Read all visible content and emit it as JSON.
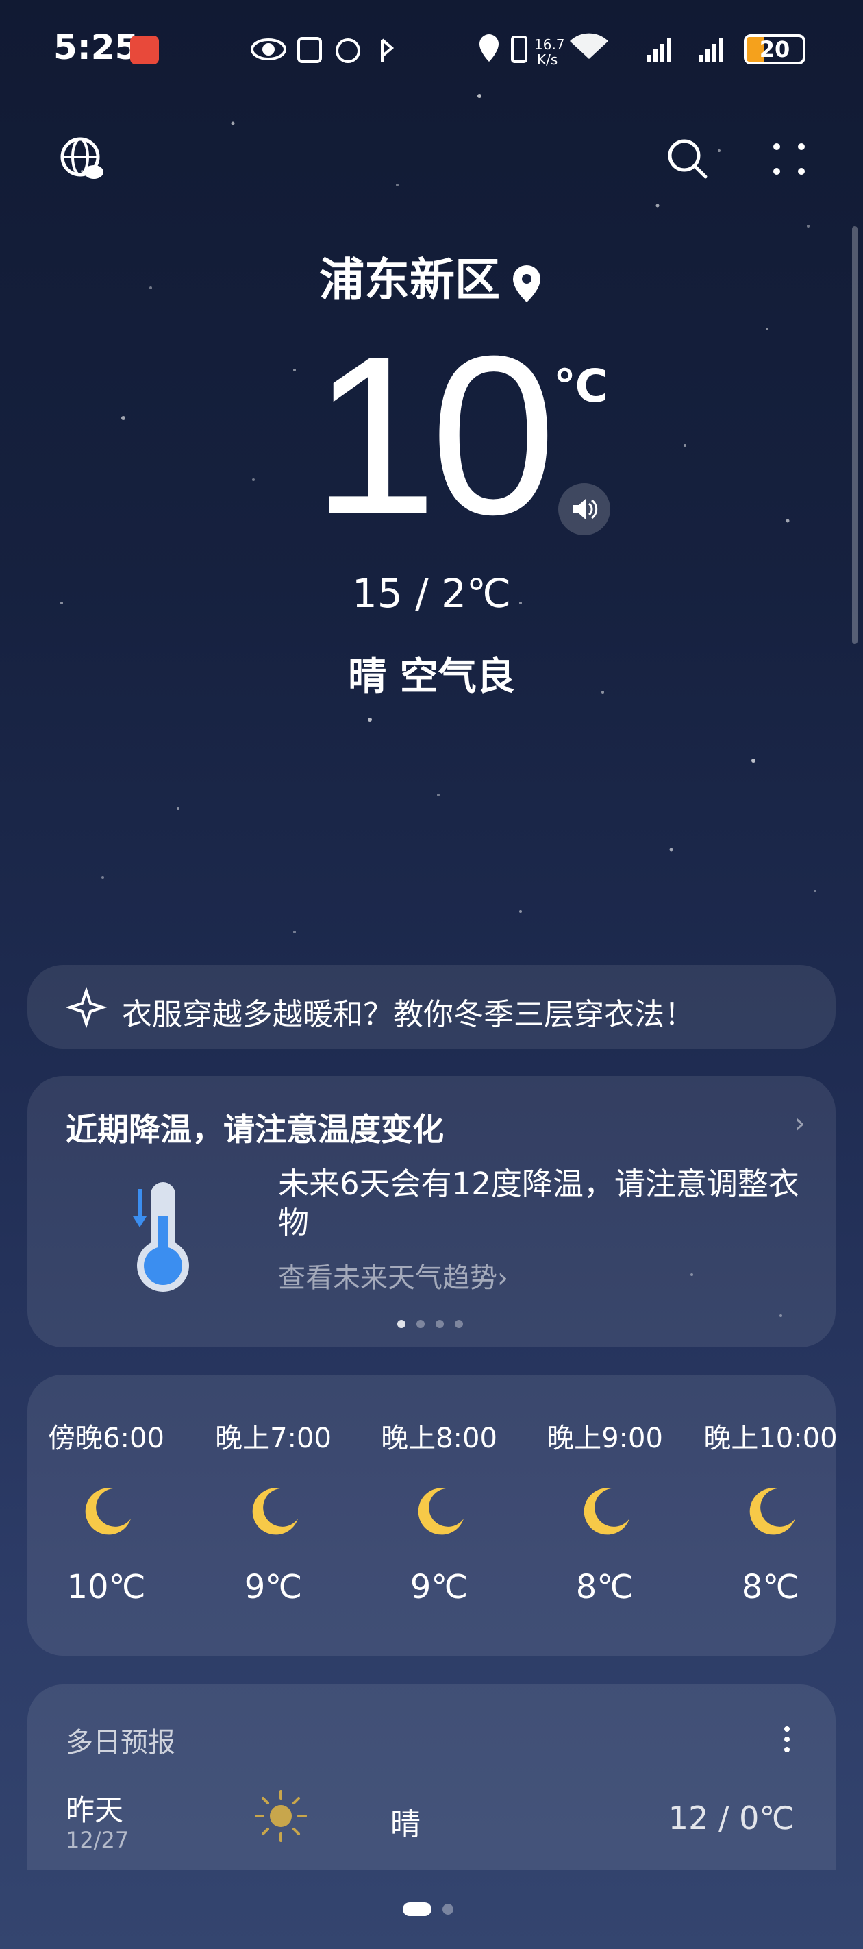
{
  "status_bar": {
    "time": "5:25",
    "network_speed": "16.7 K/s",
    "network_type": "6",
    "battery_level": "20",
    "icons": [
      "eye-icon",
      "nfc-icon",
      "alarm-icon",
      "bluetooth-icon",
      "location-icon",
      "vibrate-icon",
      "wifi-icon",
      "signal-icon",
      "signal-icon"
    ]
  },
  "toolbar": {
    "globe_icon": "globe-cloud-icon",
    "search_icon": "search-icon",
    "menu_icon": "more-dots-icon"
  },
  "current": {
    "location": "浦东新区",
    "temperature": "10",
    "unit": "℃",
    "hi_lo": "15 / 2℃",
    "condition": "晴  空气良"
  },
  "news": {
    "text": "衣服穿越多越暖和？教你冬季三层穿衣法！"
  },
  "alert": {
    "title": "近期降温，请注意温度变化",
    "message": "未来6天会有12度降温，请注意调整衣物",
    "link": "查看未来天气趋势",
    "link_chevron": "›",
    "page_dots": 4,
    "active_dot": 0
  },
  "hourly": [
    {
      "time": "傍晚6:00",
      "temp": "10℃",
      "icon": "moon-icon"
    },
    {
      "time": "晚上7:00",
      "temp": "9℃",
      "icon": "moon-icon"
    },
    {
      "time": "晚上8:00",
      "temp": "9℃",
      "icon": "moon-icon"
    },
    {
      "time": "晚上9:00",
      "temp": "8℃",
      "icon": "moon-icon"
    },
    {
      "time": "晚上10:00",
      "temp": "8℃",
      "icon": "moon-icon"
    }
  ],
  "daily": {
    "title": "多日预报",
    "rows": [
      {
        "day": "昨天",
        "date": "12/27",
        "condition": "晴",
        "range": "12 / 0℃",
        "icon": "sun-icon"
      }
    ]
  },
  "colors": {
    "accent_moon": "#f7c948",
    "battery": "#f5a11c",
    "therm_blue": "#3b8ef0"
  }
}
